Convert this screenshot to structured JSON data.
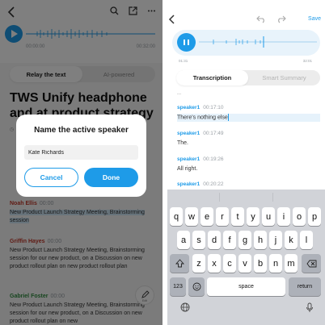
{
  "left": {
    "times": {
      "start": "00:00:00",
      "end": "00:32:00"
    },
    "tabs": [
      {
        "label": "Relay the text",
        "active": true
      },
      {
        "label": "AI-powered",
        "active": false
      }
    ],
    "title": "TWS Unify headphone and at product strategy",
    "segments": [
      {
        "speaker": "Noah Ellis",
        "time": "00:00",
        "text": "New Product Launch Strategy Meeting, Brainstorming session"
      },
      {
        "speaker": "Griffin Hayes",
        "time": "00:00",
        "text": "New Product Launch Strategy Meeting, Brainstorming session for our new product, on a Discussion on new product rollout plan on new product rollout plan"
      },
      {
        "speaker": "Gabriel Foster",
        "time": "00:00",
        "text": "New Product Launch Strategy Meeting, Brainstorming session for our new product, on a Discussion on new product rollout plan on new"
      }
    ],
    "edit_label": "Edit",
    "modal": {
      "title": "Name the active speaker",
      "input_value": "Kate Richards",
      "cancel_label": "Cancel",
      "done_label": "Done"
    }
  },
  "right": {
    "save_label": "Save",
    "times": {
      "start": "01:31",
      "end": "32:01"
    },
    "tabs": [
      {
        "label": "Transcription",
        "active": true
      },
      {
        "label": "Smart Summary",
        "active": false
      }
    ],
    "ellipsis": "...",
    "segments": [
      {
        "speaker": "speaker1",
        "time": "00:17:10",
        "text": "There's nothing else",
        "editing": true
      },
      {
        "speaker": "speaker1",
        "time": "00:17:49",
        "text": "The."
      },
      {
        "speaker": "speaker1",
        "time": "00:19:26",
        "text": "All right."
      },
      {
        "speaker": "speaker1",
        "time": "00:20:22",
        "text": ""
      }
    ],
    "keyboard": {
      "row1": [
        "q",
        "w",
        "e",
        "r",
        "t",
        "y",
        "u",
        "i",
        "o",
        "p"
      ],
      "row2": [
        "a",
        "s",
        "d",
        "f",
        "g",
        "h",
        "j",
        "k",
        "l"
      ],
      "row3": [
        "z",
        "x",
        "c",
        "v",
        "b",
        "n",
        "m"
      ],
      "num_label": "123",
      "space_label": "space",
      "return_label": "return"
    }
  },
  "colors": {
    "accent": "#1e9be8",
    "highlight": "#cfe6f6",
    "keyboard_bg": "#d1d3d8"
  }
}
